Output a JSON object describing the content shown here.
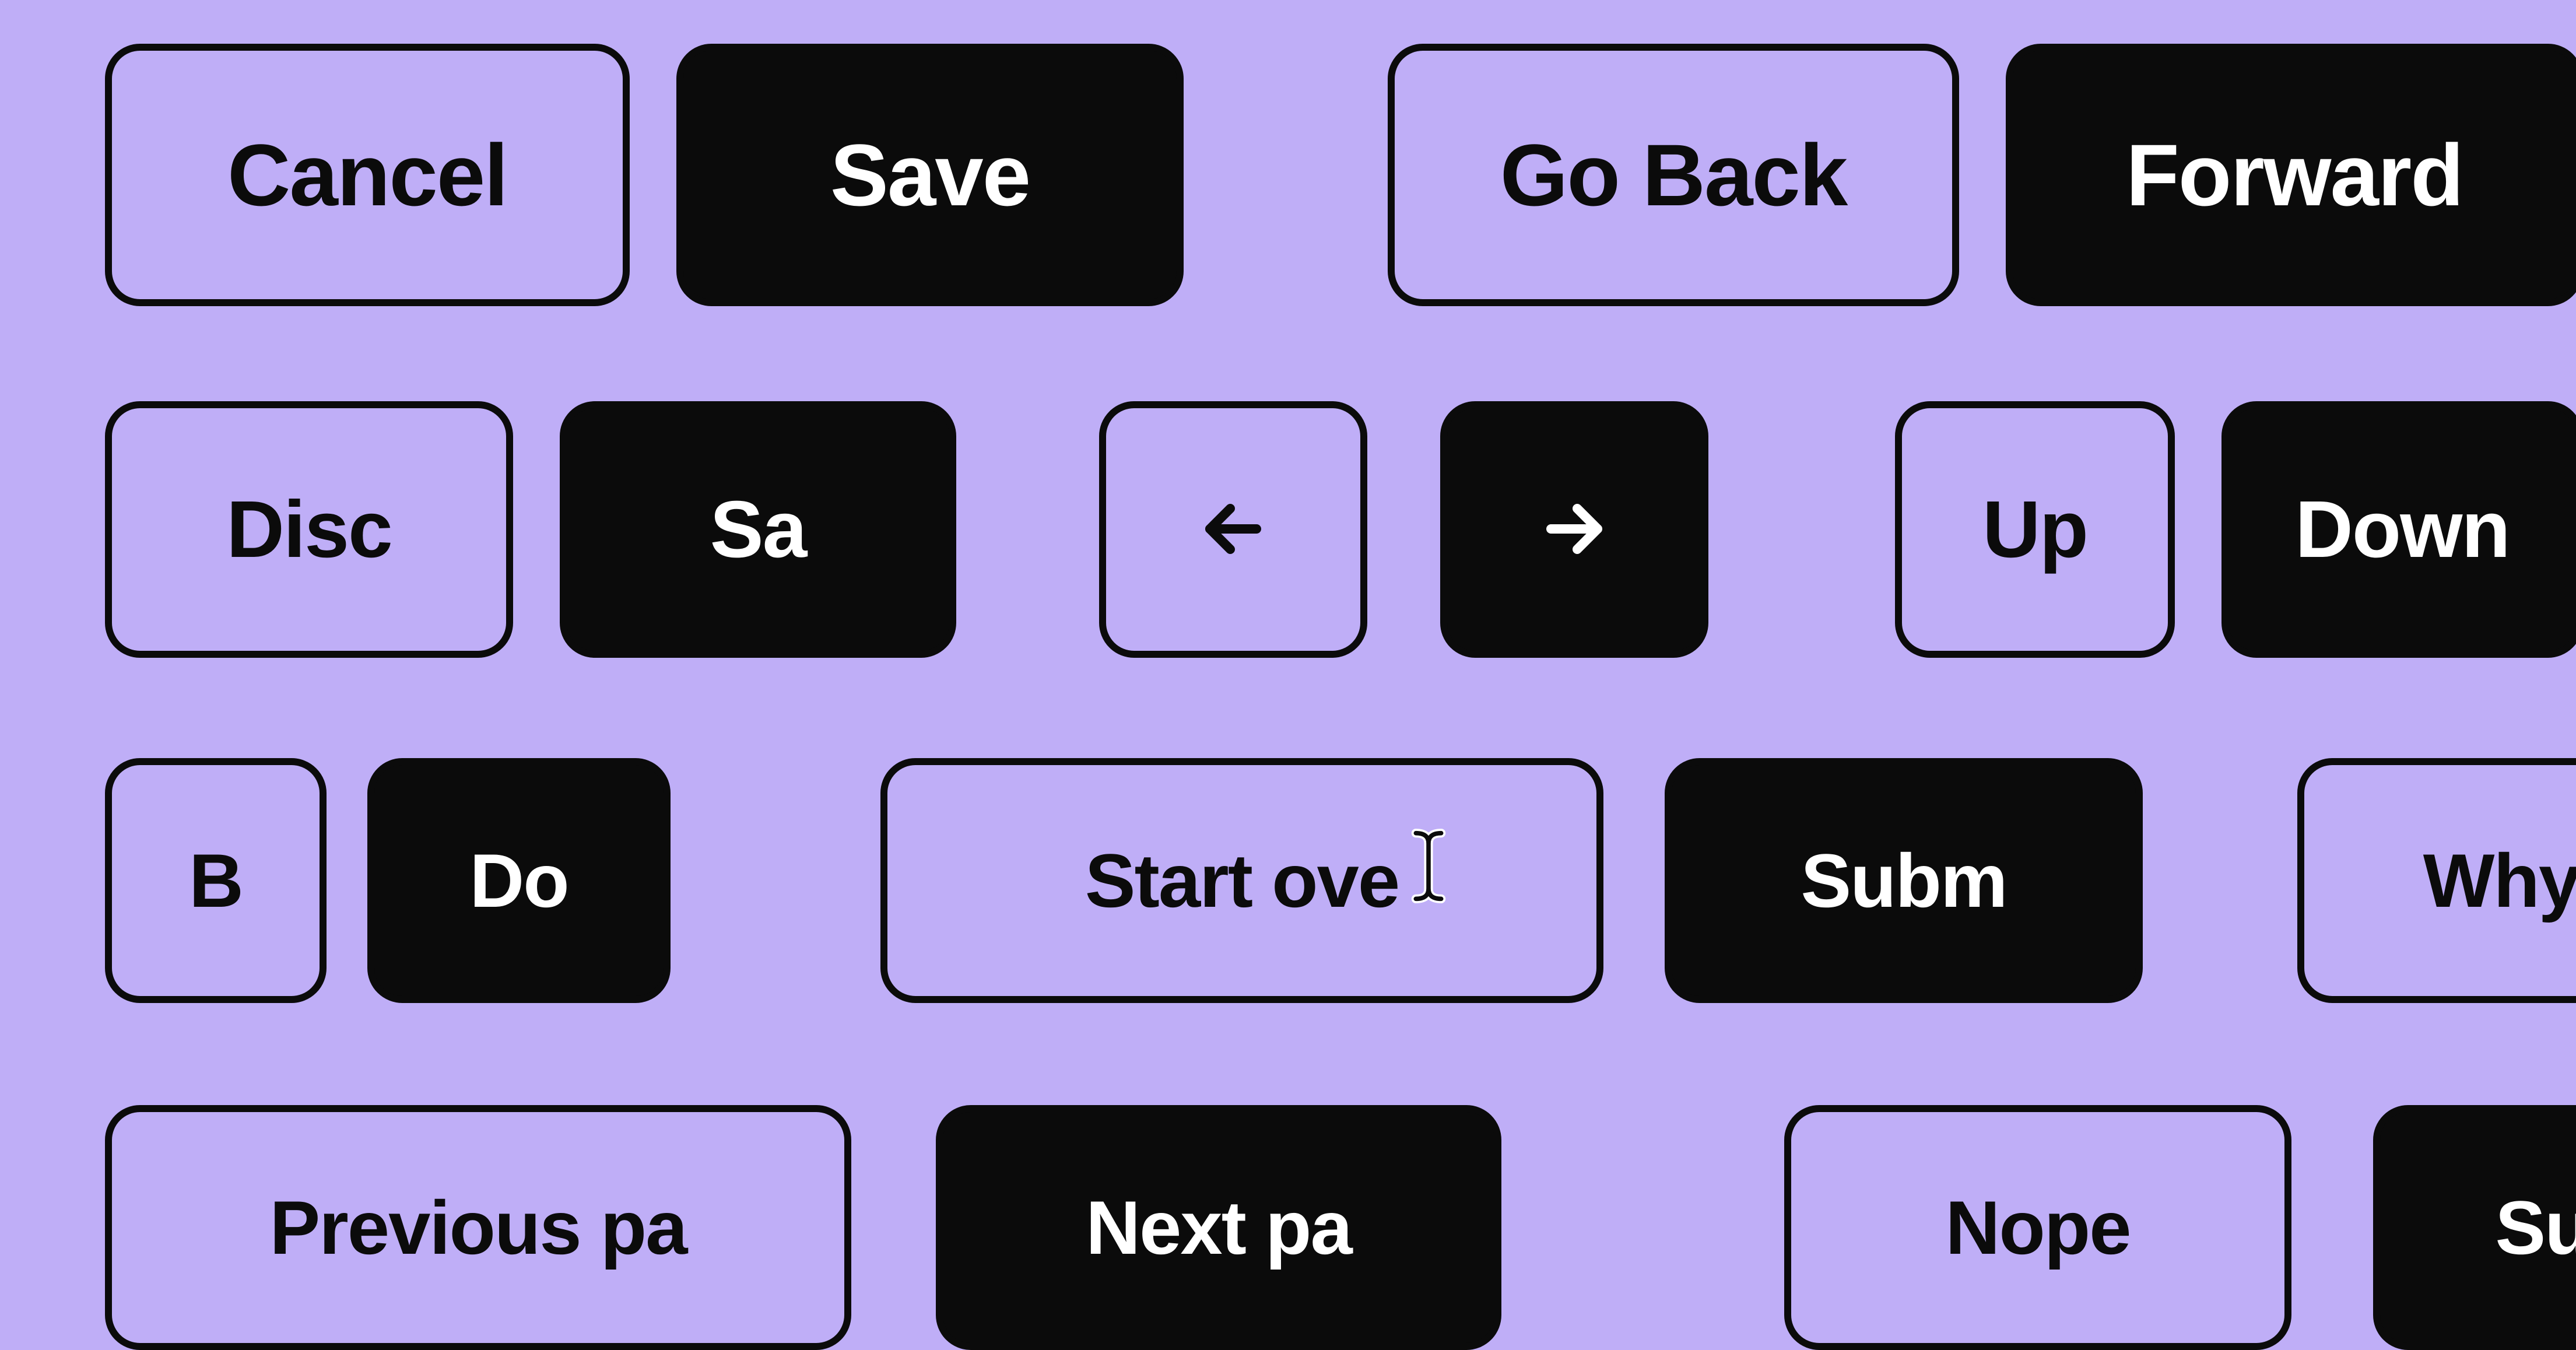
{
  "row1": {
    "cancel": "Cancel",
    "save": "Save",
    "go_back": "Go Back",
    "forward": "Forward"
  },
  "row2": {
    "disc": "Disc",
    "sa": "Sa",
    "left_arrow": "arrow-left",
    "right_arrow": "arrow-right",
    "up": "Up",
    "down": "Down"
  },
  "row3": {
    "b": "B",
    "do": "Do",
    "start_over": "Start ove",
    "subm": "Subm",
    "why": "Why"
  },
  "row4": {
    "previous_pa": "Previous pa",
    "next_pa": "Next pa",
    "nope": "Nope",
    "sure": "Sure"
  }
}
